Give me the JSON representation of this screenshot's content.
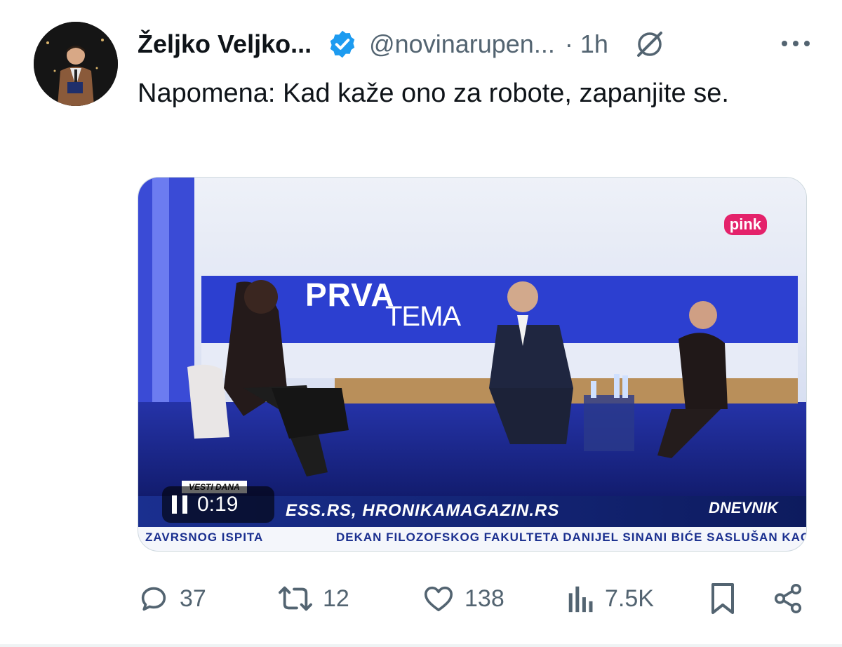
{
  "post": {
    "author_name": "Željko Veljko...",
    "handle": "@novinarupen...",
    "dot": "·",
    "time": "1h",
    "text": "Napomena: Kad kaže ono za robote, zapanjite se."
  },
  "video": {
    "elapsed": "0:19",
    "overlay": {
      "show_title_line1": "PRVA",
      "show_title_line2": "TEMA",
      "ticker_label": "VESTI DANA",
      "ticker_url": "ESS.RS, HRONIKAMAGAZIN.RS",
      "ticker_news_1": "ZAVRSNOG ISPITA",
      "ticker_news_2": "DEKAN FILOZOFSKOG FAKULTETA DANIJEL SINANI BIĆE SASLUŠAN KAO OD",
      "brand": "DNEVNIK",
      "channel": "pink"
    }
  },
  "actions": {
    "replies": "37",
    "reposts": "12",
    "likes": "138",
    "views": "7.5K"
  },
  "colors": {
    "text_primary": "#0f1419",
    "text_secondary": "#536471",
    "verified_blue": "#1d9bf0",
    "border": "#cfd9de"
  },
  "icons": [
    "verified-badge-icon",
    "grok-icon",
    "more-icon",
    "reply-icon",
    "repost-icon",
    "like-icon",
    "views-icon",
    "bookmark-icon",
    "share-icon",
    "pause-icon"
  ]
}
